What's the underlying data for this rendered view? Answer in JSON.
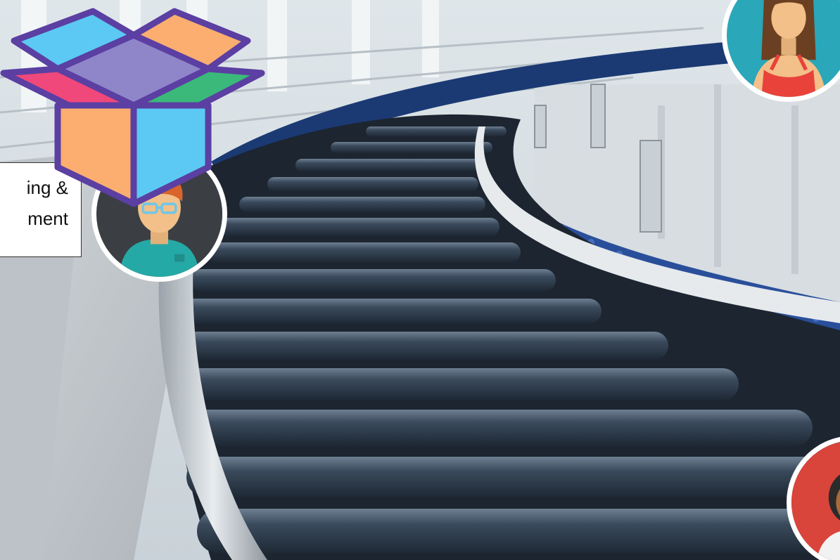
{
  "scene": {
    "label": {
      "line1": "ing &",
      "line2": "ment"
    },
    "avatars": [
      {
        "role": "man-with-glasses",
        "bg": "#3b3f44",
        "shirt": "#25a9a6"
      },
      {
        "role": "woman-red-top",
        "bg": "#2aa7b8",
        "shirt": "#e8423b"
      },
      {
        "role": "person-partial",
        "bg": "#d9443b",
        "shirt": "#f2f2f2"
      }
    ],
    "box": {
      "outline": "#5b3fa2",
      "colors": {
        "left": "#fbae6f",
        "right": "#5bc9f3",
        "top": "#8f86c9",
        "flap_pink": "#f0487a",
        "flap_green": "#3ab97a"
      }
    }
  }
}
